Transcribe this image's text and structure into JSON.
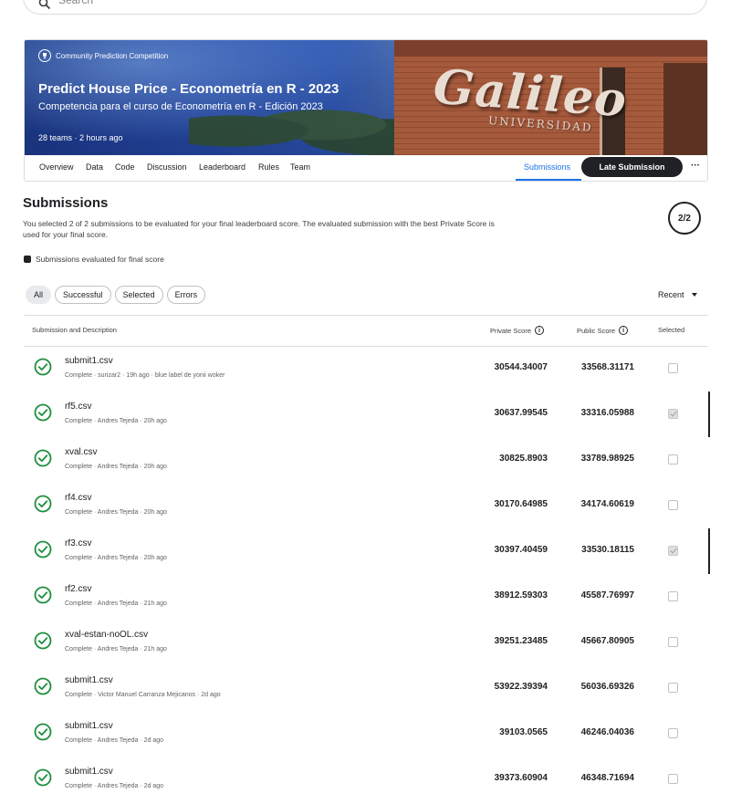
{
  "search": {
    "placeholder": "Search"
  },
  "competition": {
    "tag": "Community Prediction Competition",
    "title": "Predict House Price - Econometría en R - 2023",
    "subtitle": "Competencia para el curso de Econometría en R - Edición 2023",
    "meta": "28 teams · 2 hours ago",
    "banner_logo": "Galileo",
    "banner_logo_sub": "UNIVERSIDAD"
  },
  "tabs": [
    {
      "label": "Overview"
    },
    {
      "label": "Data"
    },
    {
      "label": "Code"
    },
    {
      "label": "Discussion"
    },
    {
      "label": "Leaderboard"
    },
    {
      "label": "Rules"
    },
    {
      "label": "Team"
    },
    {
      "label": "Submissions",
      "active": true
    }
  ],
  "late_submission_label": "Late Submission",
  "more_label": "···",
  "submissions": {
    "title": "Submissions",
    "description": "You selected 2 of 2 submissions to be evaluated for your final leaderboard score. The evaluated submission with the best Private Score is used for your final score.",
    "counter": "2/2",
    "legend": "Submissions evaluated for final score"
  },
  "filters": [
    {
      "label": "All",
      "active": true
    },
    {
      "label": "Successful"
    },
    {
      "label": "Selected"
    },
    {
      "label": "Errors"
    }
  ],
  "sort_label": "Recent",
  "table": {
    "col_submission": "Submission and Description",
    "col_private": "Private Score",
    "col_public": "Public Score",
    "col_selected": "Selected",
    "rows": [
      {
        "name": "submit1.csv",
        "desc": "Complete · surizar2 · 19h ago · blue label de yonii woker",
        "private": "30544.34007",
        "public": "33568.31171",
        "selected": false
      },
      {
        "name": "rf5.csv",
        "desc": "Complete · Andres Tejeda · 20h ago",
        "private": "30637.99545",
        "public": "33316.05988",
        "selected": true
      },
      {
        "name": "xval.csv",
        "desc": "Complete · Andres Tejeda · 20h ago",
        "private": "30825.8903",
        "public": "33789.98925",
        "selected": false
      },
      {
        "name": "rf4.csv",
        "desc": "Complete · Andres Tejeda · 20h ago",
        "private": "30170.64985",
        "public": "34174.60619",
        "selected": false
      },
      {
        "name": "rf3.csv",
        "desc": "Complete · Andres Tejeda · 20h ago",
        "private": "30397.40459",
        "public": "33530.18115",
        "selected": true
      },
      {
        "name": "rf2.csv",
        "desc": "Complete · Andres Tejeda · 21h ago",
        "private": "38912.59303",
        "public": "45587.76997",
        "selected": false
      },
      {
        "name": "xval-estan-noOL.csv",
        "desc": "Complete · Andres Tejeda · 21h ago",
        "private": "39251.23485",
        "public": "45667.80905",
        "selected": false
      },
      {
        "name": "submit1.csv",
        "desc": "Complete · Victor Manuel Carranza Mejicanos · 2d ago",
        "private": "53922.39394",
        "public": "56036.69326",
        "selected": false
      },
      {
        "name": "submit1.csv",
        "desc": "Complete · Andres Tejeda · 2d ago",
        "private": "39103.0565",
        "public": "46246.04036",
        "selected": false
      },
      {
        "name": "submit1.csv",
        "desc": "Complete · Andres Tejeda · 2d ago",
        "private": "39373.60904",
        "public": "46348.71694",
        "selected": false
      }
    ]
  },
  "colors": {
    "accent": "#1a73e8",
    "success": "#1e8e3e",
    "dark": "#202124"
  }
}
